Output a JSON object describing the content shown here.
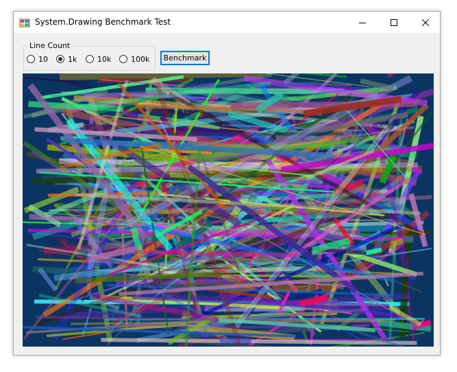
{
  "window": {
    "title": "System.Drawing Benchmark Test"
  },
  "line_count": {
    "label": "Line Count",
    "options": [
      {
        "label": "10",
        "checked": false
      },
      {
        "label": "1k",
        "checked": true
      },
      {
        "label": "10k",
        "checked": false
      },
      {
        "label": "100k",
        "checked": false
      }
    ]
  },
  "benchmark_button": {
    "label": "Benchmark"
  },
  "canvas": {
    "background": "#0c3463"
  }
}
